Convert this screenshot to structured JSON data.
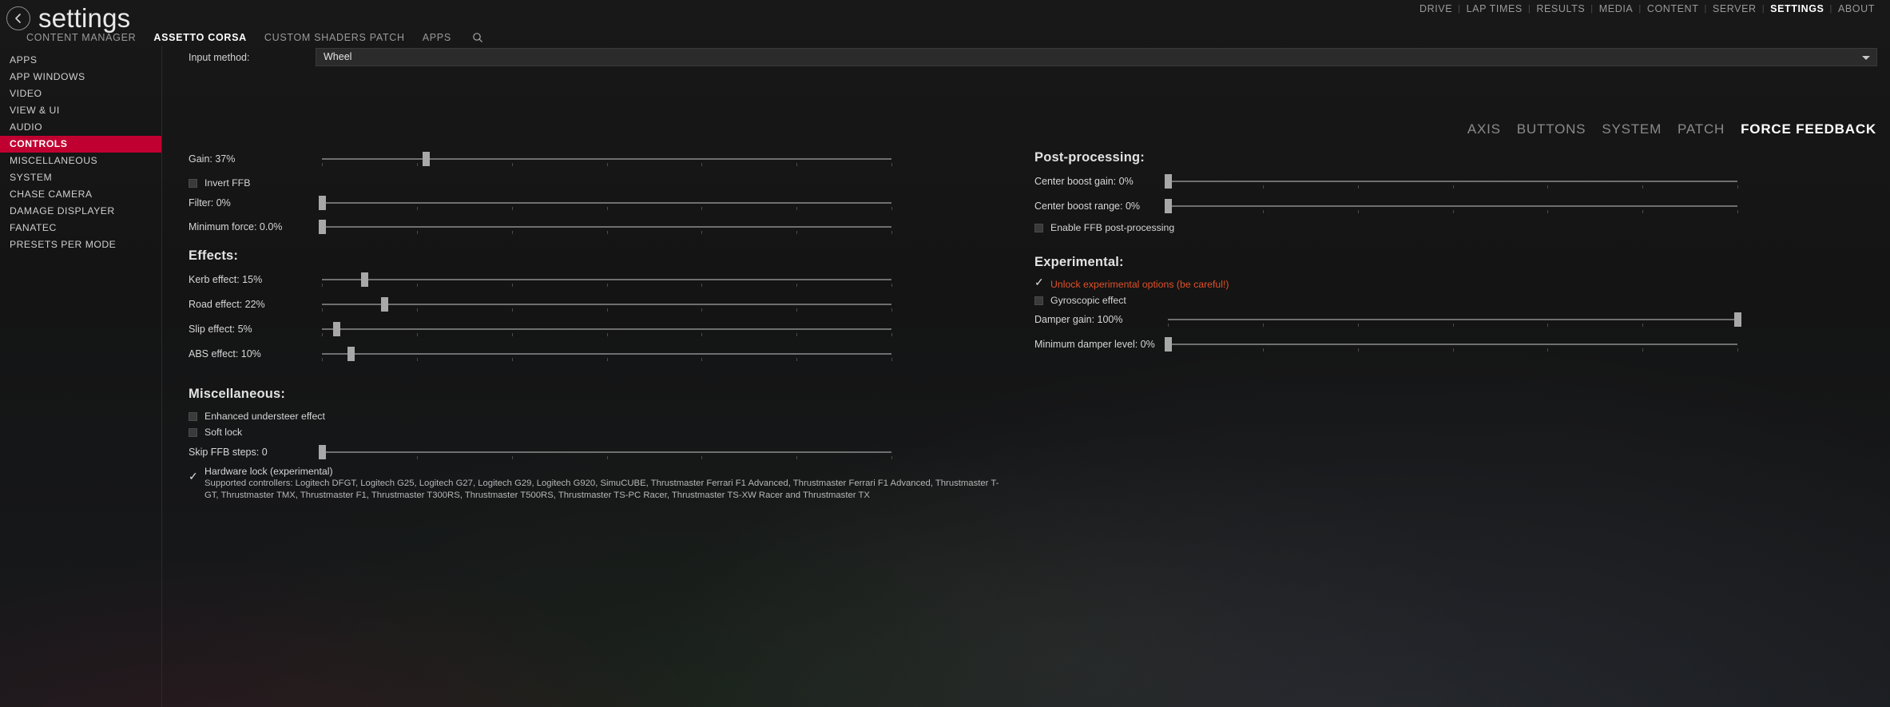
{
  "window": {
    "title": "settings",
    "back_icon": "back-arrow-icon"
  },
  "main_nav": {
    "items": [
      {
        "label": "DRIVE",
        "active": false
      },
      {
        "label": "LAP TIMES",
        "active": false
      },
      {
        "label": "RESULTS",
        "active": false
      },
      {
        "label": "MEDIA",
        "active": false
      },
      {
        "label": "CONTENT",
        "active": false
      },
      {
        "label": "SERVER",
        "active": false
      },
      {
        "label": "SETTINGS",
        "active": true
      },
      {
        "label": "ABOUT",
        "active": false
      }
    ],
    "separator": "|"
  },
  "sub_tabs": {
    "items": [
      {
        "label": "CONTENT MANAGER",
        "active": false
      },
      {
        "label": "ASSETTO CORSA",
        "active": true
      },
      {
        "label": "CUSTOM SHADERS PATCH",
        "active": false
      },
      {
        "label": "APPS",
        "active": false
      }
    ],
    "search_icon": "search-icon"
  },
  "sidebar": {
    "items": [
      {
        "label": "APPS",
        "active": false
      },
      {
        "label": "APP WINDOWS",
        "active": false
      },
      {
        "label": "VIDEO",
        "active": false
      },
      {
        "label": "VIEW & UI",
        "active": false
      },
      {
        "label": "AUDIO",
        "active": false
      },
      {
        "label": "CONTROLS",
        "active": true
      },
      {
        "label": "MISCELLANEOUS",
        "active": false
      },
      {
        "label": "SYSTEM",
        "active": false
      },
      {
        "label": "CHASE CAMERA",
        "active": false
      },
      {
        "label": "DAMAGE DISPLAYER",
        "active": false
      },
      {
        "label": "FANATEC",
        "active": false
      },
      {
        "label": "PRESETS PER MODE",
        "active": false
      }
    ],
    "active_color": "#c00030"
  },
  "input_method": {
    "label": "Input method:",
    "value": "Wheel",
    "caret_icon": "chevron-down-icon"
  },
  "ffb_tabs": {
    "items": [
      {
        "label": "AXIS",
        "active": false
      },
      {
        "label": "BUTTONS",
        "active": false
      },
      {
        "label": "SYSTEM",
        "active": false
      },
      {
        "label": "PATCH",
        "active": false
      },
      {
        "label": "FORCE FEEDBACK",
        "active": true
      }
    ]
  },
  "left_column": {
    "top_sliders": [
      {
        "label": "Gain: 37%",
        "fill": 18.3
      },
      {
        "label": "Filter: 0%",
        "fill": 0.0
      },
      {
        "label": "Minimum force: 0.0%",
        "fill": 0.0
      }
    ],
    "invert_ffb": {
      "label": "Invert FFB",
      "checked": false
    },
    "effects": {
      "heading": "Effects:",
      "sliders": [
        {
          "label": "Kerb effect: 15%",
          "fill": 7.5
        },
        {
          "label": "Road effect: 22%",
          "fill": 11.0
        },
        {
          "label": "Slip effect: 5%",
          "fill": 2.5
        },
        {
          "label": "ABS effect: 10%",
          "fill": 5.0
        }
      ]
    },
    "miscellaneous": {
      "heading": "Miscellaneous:",
      "enhanced_understeer": {
        "label": "Enhanced understeer effect",
        "checked": false
      },
      "soft_lock": {
        "label": "Soft lock",
        "checked": false
      },
      "skip_ffb_steps": {
        "label": "Skip FFB steps: 0",
        "fill": 0.0
      },
      "hardware_lock": {
        "checked": true,
        "title": "Hardware lock (experimental)",
        "description": "Supported controllers: Logitech DFGT, Logitech G25, Logitech G27, Logitech G29, Logitech G920, SimuCUBE, Thrustmaster Ferrari F1 Advanced, Thrustmaster Ferrari F1 Advanced, Thrustmaster T-GT, Thrustmaster TMX, Thrustmaster F1, Thrustmaster T300RS, Thrustmaster T500RS, Thrustmaster TS-PC Racer, Thrustmaster TS-XW Racer and Thrustmaster TX"
      }
    }
  },
  "right_column": {
    "post_processing": {
      "heading": "Post-processing:",
      "sliders": [
        {
          "label": "Center boost gain: 0%",
          "fill": 0.0
        },
        {
          "label": "Center boost range: 0%",
          "fill": 0.0
        }
      ],
      "enable_ffb_pp": {
        "label": "Enable FFB post-processing",
        "checked": false
      }
    },
    "experimental": {
      "heading": "Experimental:",
      "unlock": {
        "label": "Unlock experimental options (be careful!)",
        "checked": true,
        "color": "#e0512a"
      },
      "gyroscopic": {
        "label": "Gyroscopic effect",
        "checked": false
      },
      "sliders": [
        {
          "label": "Damper gain: 100%",
          "fill": 100.0
        },
        {
          "label": "Minimum damper level: 0%",
          "fill": 0.0
        }
      ]
    }
  }
}
